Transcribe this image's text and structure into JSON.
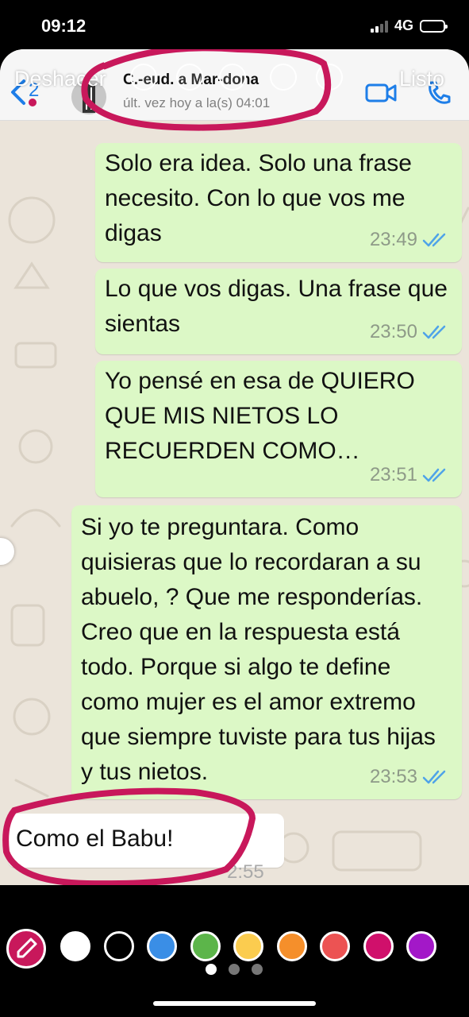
{
  "status_bar": {
    "time": "09:12",
    "network": "4G",
    "battery_level": 0.55
  },
  "story_toolbar": {
    "undo_label": "Deshacer",
    "done_label": "Listo"
  },
  "chat_header": {
    "back_count": "2",
    "contact_name": "C.-eud. a Mar-dona",
    "last_seen": "últ. vez hoy a la(s) 04:01"
  },
  "messages": [
    {
      "direction": "outgoing",
      "text": "Solo era idea. Solo una frase necesito. Con lo que vos me digas",
      "time": "23:49",
      "read": true
    },
    {
      "direction": "outgoing",
      "text": "Lo que vos digas. Una frase que sientas",
      "time": "23:50",
      "read": true
    },
    {
      "direction": "outgoing",
      "text": "Yo pensé en esa de QUIERO QUE MIS NIETOS LO RECUERDEN COMO…",
      "time": "23:51",
      "read": true
    },
    {
      "direction": "outgoing",
      "text": "Si yo te preguntara. Como quisieras que lo recordaran a su abuelo, ? Que me responderías. Creo que en la respuesta está todo. Porque si algo te define como mujer es el amor extremo que siempre tuviste para tus hijas y tus nietos.",
      "time": "23:53",
      "read": true
    },
    {
      "direction": "incoming",
      "text": "Como el Babu!",
      "time": "2:55",
      "read": false
    }
  ],
  "palette": {
    "colors": [
      "#ffffff",
      "#000000",
      "#3a8ee6",
      "#5cb54a",
      "#fbcc4f",
      "#f58f2b",
      "#ec5353",
      "#d0106b",
      "#a318c8"
    ],
    "selected_tool": "eyedropper-icon",
    "page_count": 3,
    "active_page": 1
  },
  "colors": {
    "annotation": "#c8185b",
    "outgoing_bubble": "#dcf8c6",
    "read_check": "#4fa3e8",
    "link_blue": "#1e7ee8"
  }
}
